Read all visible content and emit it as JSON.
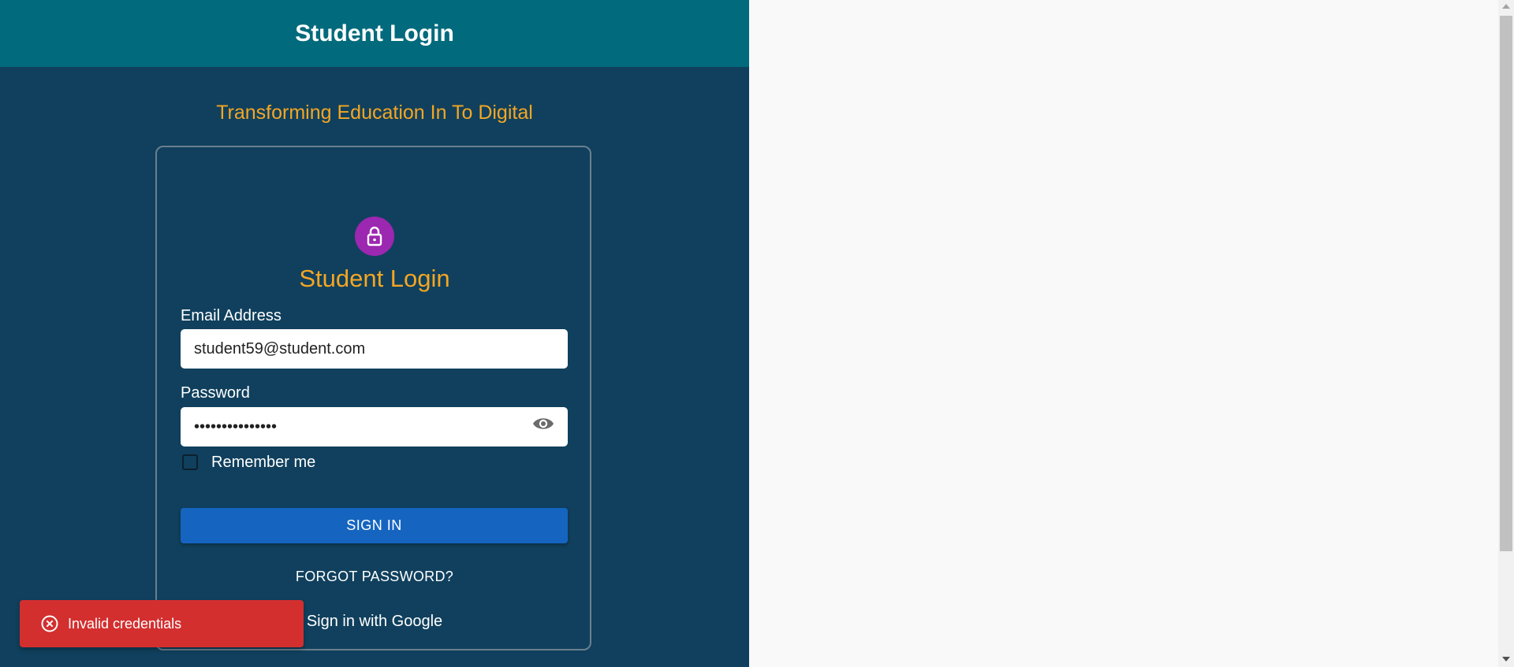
{
  "header": {
    "title": "Student Login"
  },
  "tagline": "Transforming Education In To Digital",
  "card": {
    "title": "Student Login",
    "email": {
      "label": "Email Address",
      "value": "student59@student.com"
    },
    "password": {
      "label": "Password",
      "value": "•••••••••••••••"
    },
    "remember_label": "Remember me",
    "remember_checked": false,
    "signin_label": "SIGN IN",
    "forgot_label": "FORGOT PASSWORD?",
    "google_label": "Sign in with Google"
  },
  "toast": {
    "message": "Invalid credentials",
    "color": "#d32f2f"
  },
  "colors": {
    "panel_bg": "#10405d",
    "header_bg": "#016a7c",
    "accent": "#f5a623",
    "avatar": "#9c27b0",
    "primary_button": "#1565c0"
  },
  "icons": {
    "avatar": "lock-icon",
    "password_toggle": "eye-icon",
    "toast": "error-circle-icon"
  }
}
